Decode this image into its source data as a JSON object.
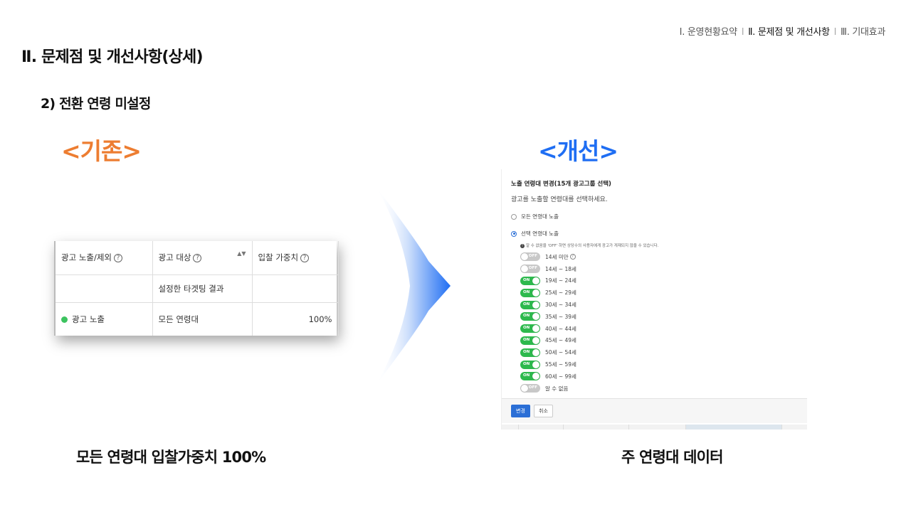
{
  "nav": {
    "item1": "Ⅰ. 운영현황요약",
    "item2": "Ⅱ. 문제점 및 개선사항",
    "item3": "Ⅲ. 기대효과",
    "separator": "Ⅰ"
  },
  "page_title": "Ⅱ. 문제점 및 개선사항(상세)",
  "section_title": "2) 전환 연령 미설정",
  "before_label": "<기존>",
  "after_label": "<개선>",
  "old_table": {
    "headers": [
      "광고 노출/제외",
      "광고 대상",
      "입찰 가중치"
    ],
    "row2": [
      "",
      "설정한 타겟팅 결과",
      ""
    ],
    "row3": [
      "광고 노출",
      "모든 연령대",
      "100%"
    ],
    "help_glyph": "?",
    "sort_glyph": "▲▼"
  },
  "panel": {
    "title": "노출 연령대 변경(15개 광고그룹 선택)",
    "description": "광고를 노출할 연령대를 선택하세요.",
    "radio_all": "모든 연령대 노출",
    "radio_selected": "선택 연령대 노출",
    "notice": "알 수 없음을 'OFF' 하면 상당수의 사용자에게 광고가 게재되지 않을 수 있습니다.",
    "toggles": [
      {
        "label": "14세 미만",
        "state": "OFF",
        "help": true
      },
      {
        "label": "14세 ~ 18세",
        "state": "OFF"
      },
      {
        "label": "19세 ~ 24세",
        "state": "ON"
      },
      {
        "label": "25세 ~ 29세",
        "state": "ON"
      },
      {
        "label": "30세 ~ 34세",
        "state": "ON"
      },
      {
        "label": "35세 ~ 39세",
        "state": "ON"
      },
      {
        "label": "40세 ~ 44세",
        "state": "ON"
      },
      {
        "label": "45세 ~ 49세",
        "state": "ON"
      },
      {
        "label": "50세 ~ 54세",
        "state": "ON"
      },
      {
        "label": "55세 ~ 59세",
        "state": "ON"
      },
      {
        "label": "60세 ~ 99세",
        "state": "ON"
      },
      {
        "label": "알 수 없음",
        "state": "OFF"
      }
    ],
    "btn_change": "변경",
    "btn_cancel": "취소"
  },
  "caption_left": "모든 연령대 입찰가중치 100%",
  "caption_right": "주 연령대 데이터",
  "colors": {
    "before": "#ed7d31",
    "after": "#1f6ef3",
    "toggle_on": "#2db94d",
    "primary_button": "#2b6fd6"
  }
}
